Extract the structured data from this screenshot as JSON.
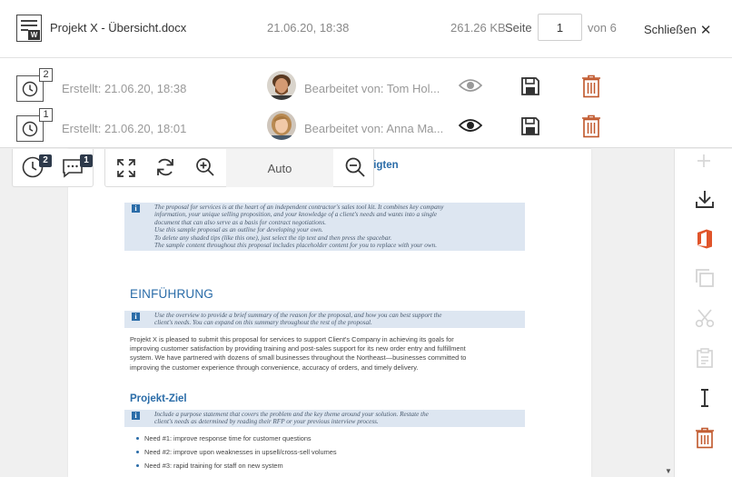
{
  "header": {
    "filename": "Projekt X - Übersicht.docx",
    "date": "21.06.20, 18:38",
    "size": "261.26 KB",
    "page_label": "Seite",
    "page_value": "1",
    "page_of": "von 6",
    "close_label": "Schließen",
    "doc_icon_letter": "W"
  },
  "versions": [
    {
      "number": "2",
      "created": "Erstellt: 21.06.20, 18:38",
      "editor": "Bearbeitet von: Tom Hol..."
    },
    {
      "number": "1",
      "created": "Erstellt: 21.06.20, 18:01",
      "editor": "Bearbeitet von: Anna Ma..."
    }
  ],
  "toolbar": {
    "history_badge": "2",
    "comments_badge": "1",
    "zoom_value": "Auto"
  },
  "document": {
    "heading_peek": "ligten",
    "tip1": [
      "The proposal for services is at the heart of an independent contractor's sales tool kit. It combines key company",
      "information, your unique selling proposition, and your knowledge of a client's needs and wants into a single",
      "document that can also serve as a basis for contract negotiations.",
      "Use this sample proposal as an outline for developing your own.",
      "To delete any shaded tips (like this one), just select the tip text and then press the spacebar.",
      "The sample content throughout this proposal includes placeholder content for you to replace with your own."
    ],
    "h1": "EINFÜHRUNG",
    "tip2": [
      "Use the overview to provide a brief summary of the reason for the proposal, and how you can best support the",
      "client's needs. You can expand on this summary throughout the rest of the proposal."
    ],
    "body": [
      "Projekt X is pleased to submit this proposal for services to support Client's Company in achieving its goals for",
      "improving customer satisfaction by providing training and post-sales support for its new order entry and fulfillment",
      "system. We have partnered with dozens of small businesses throughout the Northeast—businesses committed to",
      "improving the customer experience through convenience, accuracy of orders, and timely delivery."
    ],
    "h2": "Projekt-Ziel",
    "tip3": [
      "Include a purpose statement that covers the problem and the key theme around your solution. Restate the",
      "client's needs as determined by reading their RFP or your previous interview process."
    ],
    "bullets": [
      "Need #1: improve response time for customer questions",
      "Need #2: improve upon weaknesses in upsell/cross-sell volumes",
      "Need #3: rapid training for staff on new system"
    ]
  },
  "colors": {
    "accent": "#2a6ca8",
    "delete": "#c0562a",
    "office": "#e0542a",
    "badge": "#2e3a4b",
    "tip_bg": "#dde6f1"
  },
  "icons": {
    "sidebar": [
      "add-icon",
      "download-icon",
      "office-icon",
      "copy-icon",
      "cut-icon",
      "paste-icon",
      "text-cursor-icon",
      "delete-icon"
    ],
    "toolbar": [
      "history-icon",
      "comments-icon",
      "fullscreen-icon",
      "rotate-icon",
      "zoom-in-icon",
      "zoom-out-icon"
    ]
  }
}
